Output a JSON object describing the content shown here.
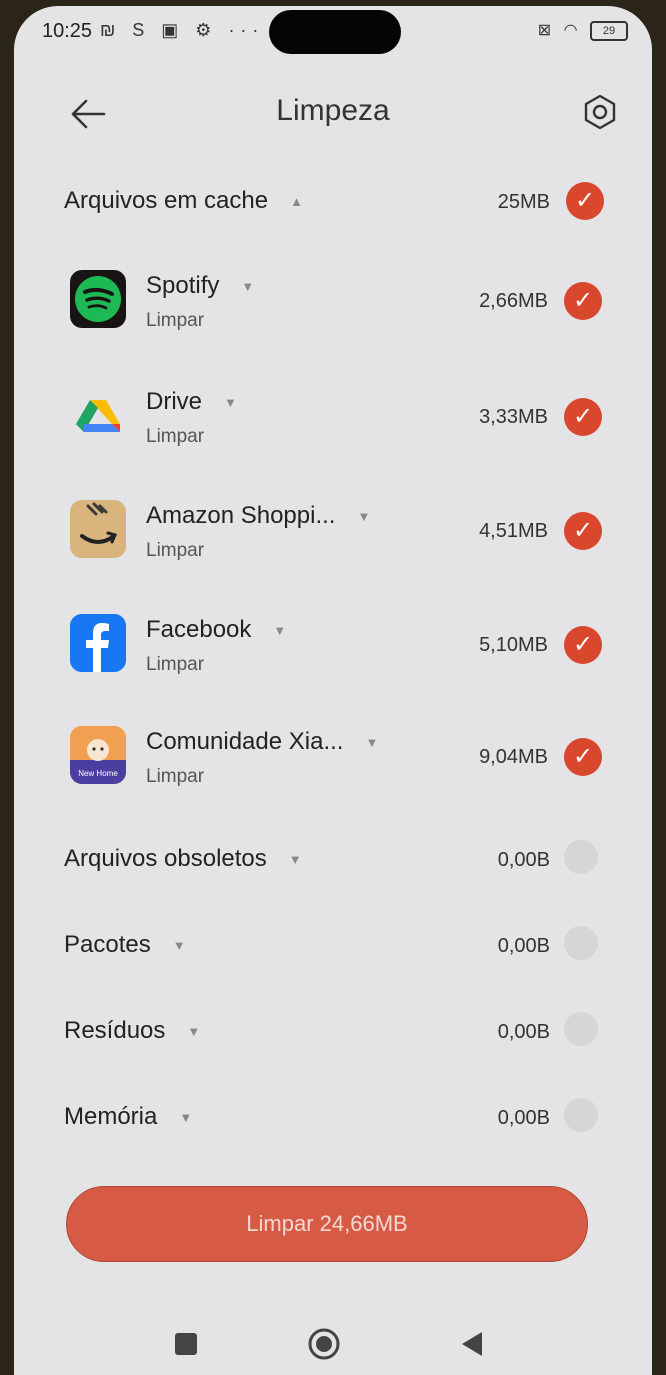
{
  "status_bar": {
    "time": "10:25",
    "left_icons": "₪ S ▣ ⚙ ···",
    "battery": "29"
  },
  "header": {
    "title": "Limpeza"
  },
  "sections": {
    "cache": {
      "label": "Arquivos em cache",
      "size": "25MB",
      "checked": true
    },
    "obsolete": {
      "label": "Arquivos obsoletos",
      "size": "0,00B",
      "checked": false
    },
    "packages": {
      "label": "Pacotes",
      "size": "0,00B",
      "checked": false
    },
    "residues": {
      "label": "Resíduos",
      "size": "0,00B",
      "checked": false
    },
    "memory": {
      "label": "Memória",
      "size": "0,00B",
      "checked": false
    }
  },
  "apps": [
    {
      "name": "Spotify",
      "sub": "Limpar",
      "size": "2,66MB",
      "icon": "spotify-icon",
      "color": "#1db954"
    },
    {
      "name": "Drive",
      "sub": "Limpar",
      "size": "3,33MB",
      "icon": "drive-icon",
      "color": "#1fa463"
    },
    {
      "name": "Amazon Shoppi...",
      "sub": "Limpar",
      "size": "4,51MB",
      "icon": "amazon-icon",
      "color": "#d9b47c"
    },
    {
      "name": "Facebook",
      "sub": "Limpar",
      "size": "5,10MB",
      "icon": "facebook-icon",
      "color": "#1877f2"
    },
    {
      "name": "Comunidade Xia...",
      "sub": "Limpar",
      "size": "9,04MB",
      "icon": "xiaomi-community-icon",
      "color": "#e87b2e",
      "icon_text": "New Home"
    }
  ],
  "clean_button": {
    "label": "Limpar 24,66MB"
  },
  "colors": {
    "accent": "#d9472d",
    "background": "#e4e4e6"
  }
}
